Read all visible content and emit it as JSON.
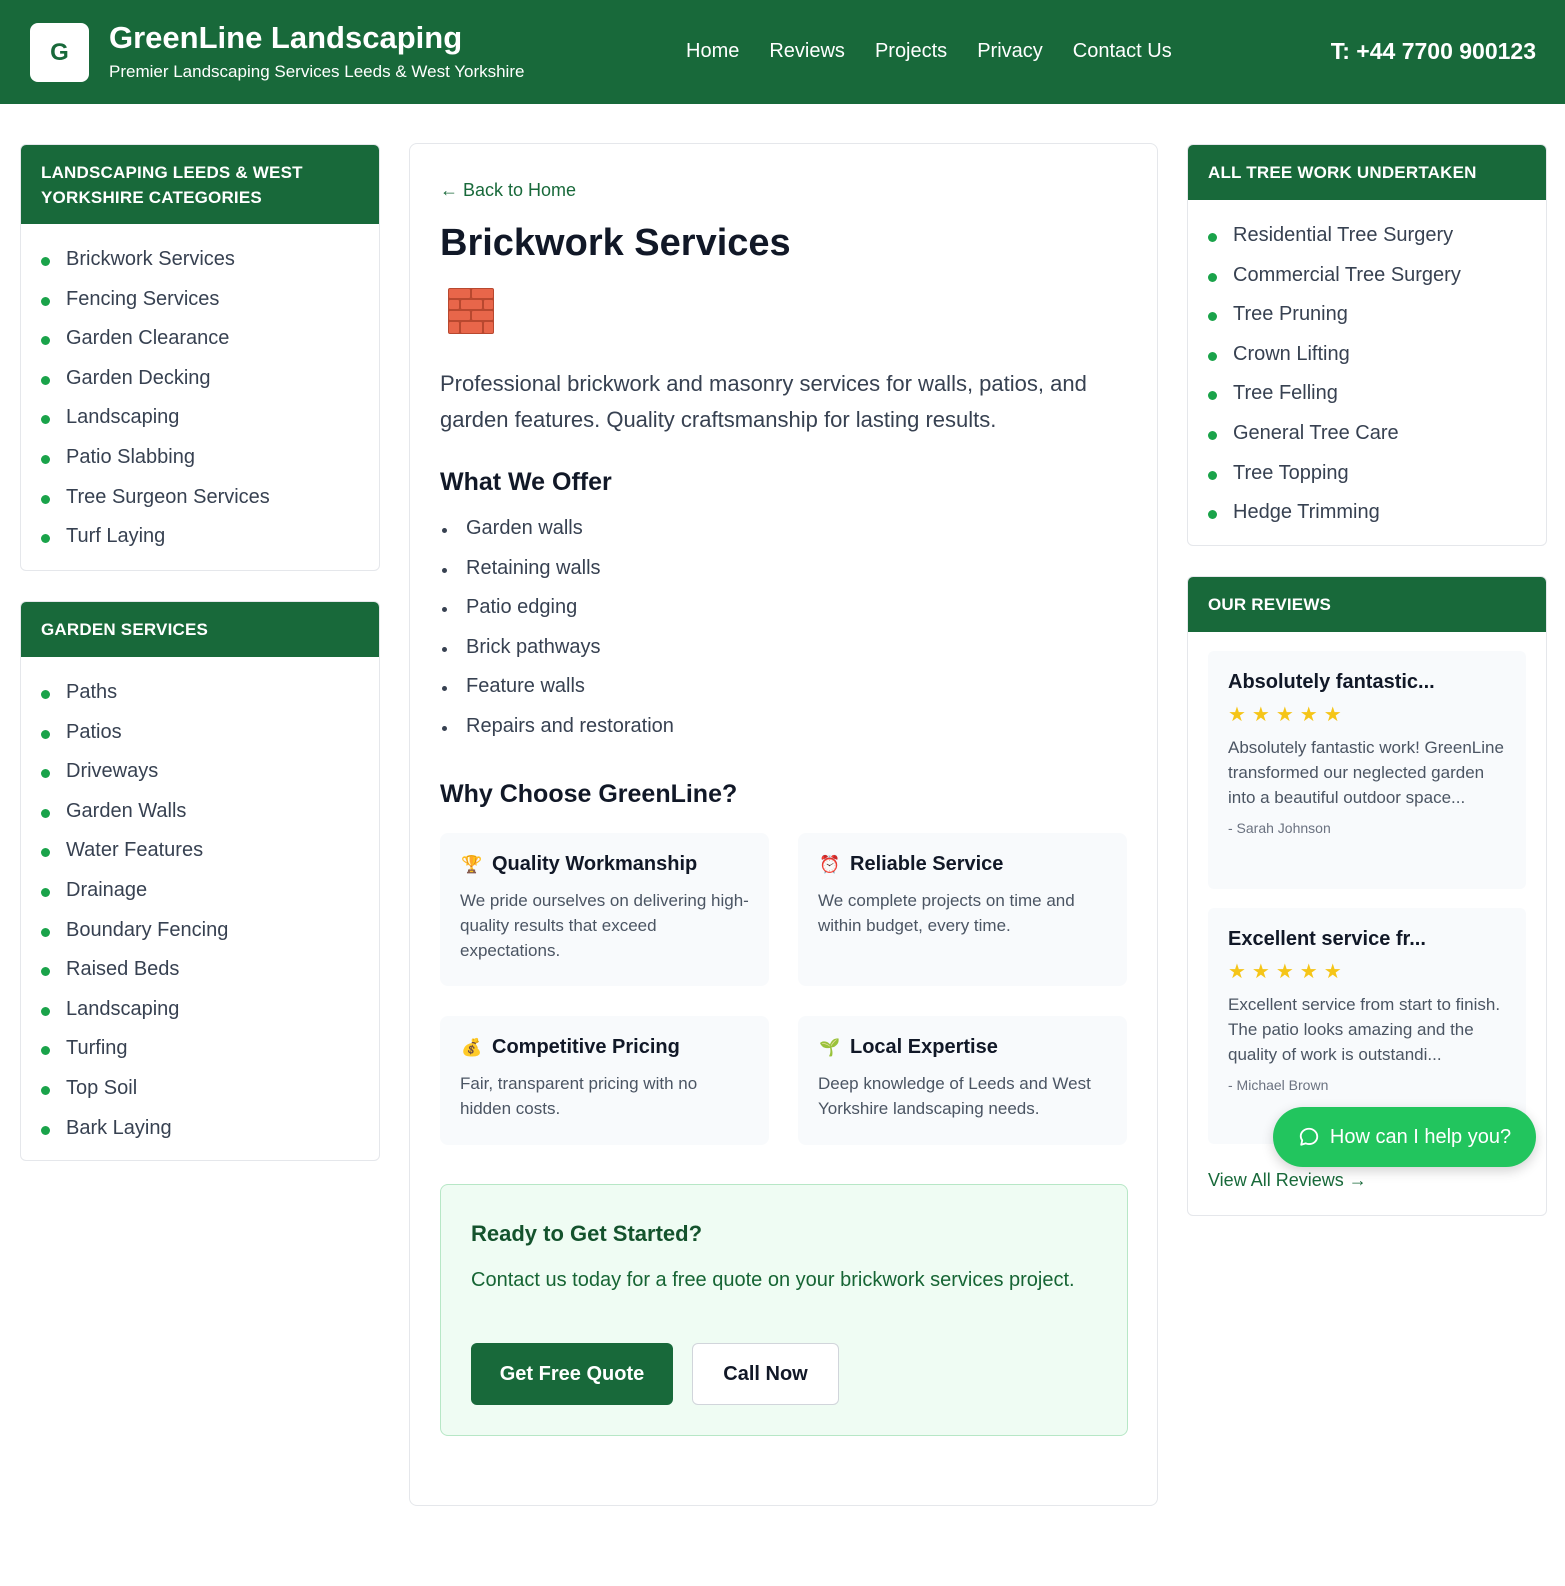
{
  "header": {
    "logo_letter": "G",
    "brand_title": "GreenLine Landscaping",
    "brand_subtitle": "Premier Landscaping Services Leeds & West Yorkshire",
    "nav": [
      "Home",
      "Reviews",
      "Projects",
      "Privacy",
      "Contact Us"
    ],
    "phone": "T: +44 7700 900123"
  },
  "categories_panel": {
    "title": "Landscaping Leeds & West Yorkshire Categories",
    "items": [
      "Brickwork Services",
      "Fencing Services",
      "Garden Clearance",
      "Garden Decking",
      "Landscaping",
      "Patio Slabbing",
      "Tree Surgeon Services",
      "Turf Laying"
    ]
  },
  "garden_panel": {
    "title": "Garden Services",
    "items": [
      "Paths",
      "Patios",
      "Driveways",
      "Garden Walls",
      "Water Features",
      "Drainage",
      "Boundary Fencing",
      "Raised Beds",
      "Landscaping",
      "Turfing",
      "Top Soil",
      "Bark Laying"
    ]
  },
  "tree_panel": {
    "title": "All Tree Work Undertaken",
    "items": [
      "Residential Tree Surgery",
      "Commercial Tree Surgery",
      "Tree Pruning",
      "Crown Lifting",
      "Tree Felling",
      "General Tree Care",
      "Tree Topping",
      "Hedge Trimming"
    ]
  },
  "reviews_panel": {
    "title": "Our Reviews",
    "reviews": [
      {
        "title": "Absolutely fantastic...",
        "stars": "★★★★★",
        "rating": 5,
        "text": "Absolutely fantastic work! GreenLine transformed our neglected garden into a beautiful outdoor space...",
        "author": "- Sarah Johnson"
      },
      {
        "title": "Excellent service fr...",
        "stars": "★★★★★",
        "rating": 5,
        "text": "Excellent service from start to finish. The patio looks amazing and the quality of work is outstandi...",
        "author": "- Michael Brown"
      }
    ],
    "view_all": "View All Reviews →"
  },
  "main": {
    "back_link": "← Back to Home",
    "title": "Brickwork Services",
    "title_icon": "brick-wall-icon",
    "intro": "Professional brickwork and masonry services for walls, patios, and garden features. Quality craftsmanship for lasting results.",
    "offer_heading": "What We Offer",
    "offer_items": [
      "Garden walls",
      "Retaining walls",
      "Patio edging",
      "Brick pathways",
      "Feature walls",
      "Repairs and restoration"
    ],
    "why_heading": "Why Choose GreenLine?",
    "features": [
      {
        "icon": "trophy-icon",
        "glyph": "🏆",
        "title": "Quality Workmanship",
        "text": "We pride ourselves on delivering high-quality results that exceed expectations."
      },
      {
        "icon": "alarm-clock-icon",
        "glyph": "⏰",
        "title": "Reliable Service",
        "text": "We complete projects on time and within budget, every time."
      },
      {
        "icon": "money-bag-icon",
        "glyph": "💰",
        "title": "Competitive Pricing",
        "text": "Fair, transparent pricing with no hidden costs."
      },
      {
        "icon": "seedling-icon",
        "glyph": "🌱",
        "title": "Local Expertise",
        "text": "Deep knowledge of Leeds and West Yorkshire landscaping needs."
      }
    ],
    "cta": {
      "title": "Ready to Get Started?",
      "text": "Contact us today for a free quote on your brickwork services project.",
      "primary_button": "Get Free Quote",
      "secondary_button": "Call Now"
    }
  },
  "chat_widget": {
    "label": "How can I help you?",
    "icon": "chat-bubble-icon"
  },
  "colors": {
    "brand_green": "#18693a",
    "bullet_green": "#1aa34a",
    "chat_green": "#22c55e",
    "star_yellow": "#f5c518",
    "cta_background": "#effcf3"
  }
}
